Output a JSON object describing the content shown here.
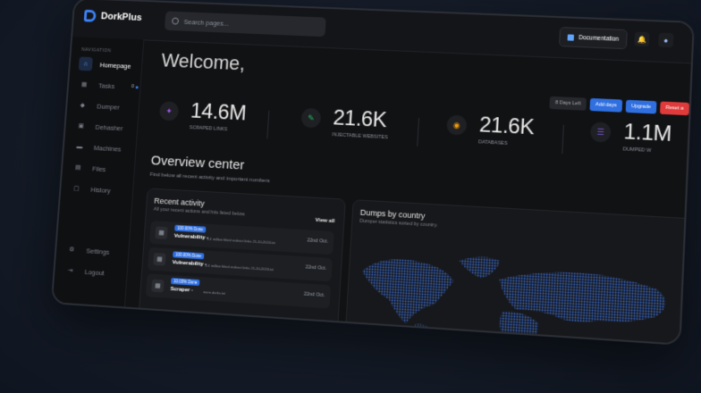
{
  "app": {
    "name": "DorkPlus",
    "accent": "#3b82f6"
  },
  "search": {
    "placeholder": "Search pages..."
  },
  "header": {
    "documentation": "Documentation"
  },
  "sidebar": {
    "heading": "NAVIGATION",
    "items": [
      {
        "label": "Homepage",
        "icon": "home-icon",
        "active": true
      },
      {
        "label": "Tasks",
        "icon": "grid-icon",
        "badge": "0"
      },
      {
        "label": "Dumper",
        "icon": "bell-icon"
      },
      {
        "label": "Dehasher",
        "icon": "lock-icon"
      },
      {
        "label": "Machines",
        "icon": "monitor-icon"
      },
      {
        "label": "Files",
        "icon": "file-icon"
      },
      {
        "label": "History",
        "icon": "history-icon"
      }
    ],
    "footer": [
      {
        "label": "Settings",
        "icon": "gear-icon"
      },
      {
        "label": "Logout",
        "icon": "logout-icon"
      }
    ]
  },
  "main": {
    "welcome": "Welcome,",
    "days_left": "8 Days Left",
    "add_days": "Add days",
    "upgrade": "Upgrade",
    "reset": "Reset a",
    "stats": [
      {
        "value": "14.6M",
        "label": "SCRAPED LINKS",
        "color": "#a855f7"
      },
      {
        "value": "21.6K",
        "label": "INJECTABLE WEBSITES",
        "color": "#22c55e"
      },
      {
        "value": "21.6K",
        "label": "DATABASES",
        "color": "#f59e0b"
      },
      {
        "value": "1.1M",
        "label": "DUMPED W",
        "color": "#8b5cf6"
      }
    ],
    "overview_title": "Overview center",
    "overview_sub": "Find below all recent activity and important numbers",
    "recent": {
      "title": "Recent activity",
      "subtitle": "All your recent actions and hits listed below.",
      "view_all": "View all",
      "items": [
        {
          "tag": "100.00% Done",
          "name": "Vulnerability -",
          "desc": "4.4 million fitted redirect links 21-10-2024.txt",
          "date": "22nd Oct."
        },
        {
          "tag": "100.00% Done",
          "name": "Vulnerability -",
          "desc": "4.4 million fitted redirect links 21-10-2024.txt",
          "date": "22nd Oct."
        },
        {
          "tag": "10.03% Done",
          "name": "Scraper -",
          "desc": "mem dorks.txt",
          "date": "22nd Oct."
        }
      ]
    },
    "dumps": {
      "title": "Dumps by country",
      "subtitle": "Dumper statistics sorted by country."
    }
  }
}
